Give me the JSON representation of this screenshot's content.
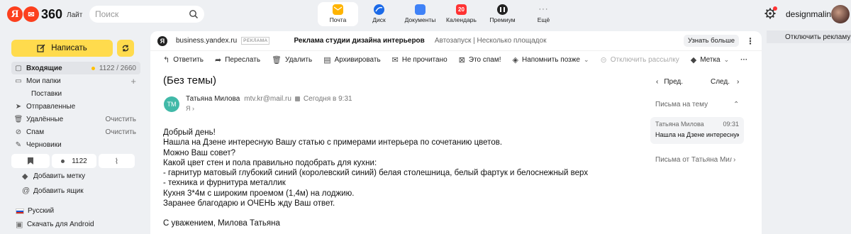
{
  "header": {
    "logo_letter": "Я",
    "logo_brand": "360",
    "logo_suffix": "Лайт",
    "search_placeholder": "Поиск",
    "apps": [
      {
        "label": "Почта",
        "icon": "mail-icon",
        "color": "#ffb400",
        "active": true
      },
      {
        "label": "Диск",
        "icon": "disk-icon",
        "color": "#1b6ae8"
      },
      {
        "label": "Документы",
        "icon": "documents-icon",
        "color": "#3f82f7"
      },
      {
        "label": "Календарь",
        "icon": "calendar-icon",
        "badge": "20",
        "color": "#f33"
      },
      {
        "label": "Премиум",
        "icon": "premium-icon",
        "color": "#222"
      },
      {
        "label": "Ещё",
        "icon": "more-icon",
        "color": "#888"
      }
    ],
    "username": "designmalina"
  },
  "sidebar": {
    "compose_label": "Написать",
    "folders": [
      {
        "label": "Входящие",
        "count": "1122 / 2660",
        "icon": "inbox-icon"
      },
      {
        "label": "Мои папки",
        "icon": "folders-icon",
        "action": "+"
      },
      {
        "label": "Поставки"
      },
      {
        "label": "Отправленные",
        "icon": "sent-icon"
      },
      {
        "label": "Удалённые",
        "icon": "trash-icon",
        "action": "Очистить"
      },
      {
        "label": "Спам",
        "icon": "spam-icon",
        "action": "Очистить"
      },
      {
        "label": "Черновики",
        "icon": "drafts-icon"
      }
    ],
    "quick_unread_count": "1122",
    "add_label": "Добавить метку",
    "add_mailbox": "Добавить ящик",
    "language": "Русский",
    "download_android": "Скачать для Android"
  },
  "ad": {
    "domain": "business.yandex.ru",
    "tag": "РЕКЛАМА",
    "title": "Реклама студии дизайна интерьеров",
    "subtitle": "Автозапуск | Несколько площадок",
    "more_button": "Узнать больше",
    "disable_ads": "Отключить рекламу"
  },
  "toolbar": {
    "reply": "Ответить",
    "forward": "Переслать",
    "delete": "Удалить",
    "archive": "Архивировать",
    "unread": "Не прочитано",
    "spam": "Это спам!",
    "remind": "Напомнить позже",
    "unsubscribe": "Отключить рассылку",
    "label": "Метка"
  },
  "message": {
    "subject": "(Без темы)",
    "prev": "Пред.",
    "next": "След.",
    "sender_initials": "ТМ",
    "sender_name": "Татьяна Милова",
    "sender_email": "mtv.kr@mail.ru",
    "time": "Сегодня в 9:31",
    "to": "Я",
    "body": [
      "Добрый день!",
      "Нашла на Дзене интересную Вашу статью с примерами интерьера по сочетанию цветов.",
      "Можно Ваш совет?",
      "Какой цвет стен и пола правильно подобрать для кухни:",
      "- гарнитур матовый глубокий синий (королевский синий) белая столешница, белый фартук и белоснежный верх",
      "- техника и фурнитура металлик",
      "Кухня 3*4м с широким проемом (1,4м) на лоджию.",
      "Заранее благодарю и ОЧЕНЬ жду Ваш ответ.",
      "",
      "С уважением, Милова Татьяна"
    ]
  },
  "thread": {
    "header": "Письма на тему",
    "item_sender": "Татьяна Милова",
    "item_time": "09:31",
    "item_subject": "Нашла на Дзене интересную",
    "from_sender": "Письма от Татьяна Милова"
  }
}
